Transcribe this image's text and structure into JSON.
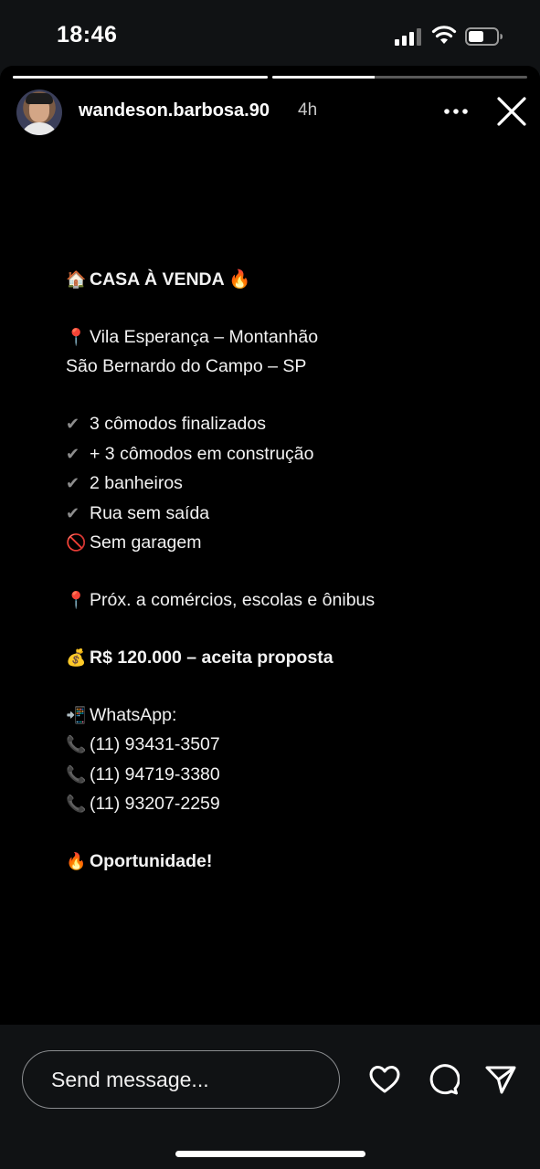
{
  "status_bar": {
    "time": "18:46",
    "signal_icon": "cellular-signal-icon",
    "wifi_icon": "wifi-icon",
    "battery_icon": "battery-icon"
  },
  "story": {
    "progress": [
      1.0,
      0.4
    ],
    "username": "wandeson.barbosa.90",
    "time_ago": "4h",
    "more_icon": "more-options-icon",
    "close_icon": "close-icon",
    "post": {
      "title": "CASA À VENDA",
      "title_emoji_left": "🏠",
      "title_emoji_right": "🔥",
      "location_pin": "📍",
      "location_line1": "Vila Esperança – Montanhão",
      "location_line2": "São Bernardo do Campo – SP",
      "check_mark": "✔",
      "features": [
        "3 cômodos finalizados",
        "+ 3 cômodos em construção",
        "2 banheiros",
        "Rua sem saída"
      ],
      "no_garage_emoji": "🚫",
      "no_garage": "Sem garagem",
      "nearby_pin": "📍",
      "nearby": "Próx. a comércios, escolas e ônibus",
      "price_emoji": "💰",
      "price": "R$ 120.000 – aceita proposta",
      "whatsapp_emoji": "📲",
      "whatsapp_label": "WhatsApp:",
      "phone_emoji": "📞",
      "phones": [
        "(11) 93431-3507",
        "(11) 94719-3380",
        "(11) 93207-2259"
      ],
      "closing_emoji": "🔥",
      "closing": "Oportunidade!"
    }
  },
  "bottom_bar": {
    "message_placeholder": "Send message...",
    "like_icon": "heart-icon",
    "comment_icon": "chat-bubble-icon",
    "share_icon": "paper-plane-icon"
  }
}
